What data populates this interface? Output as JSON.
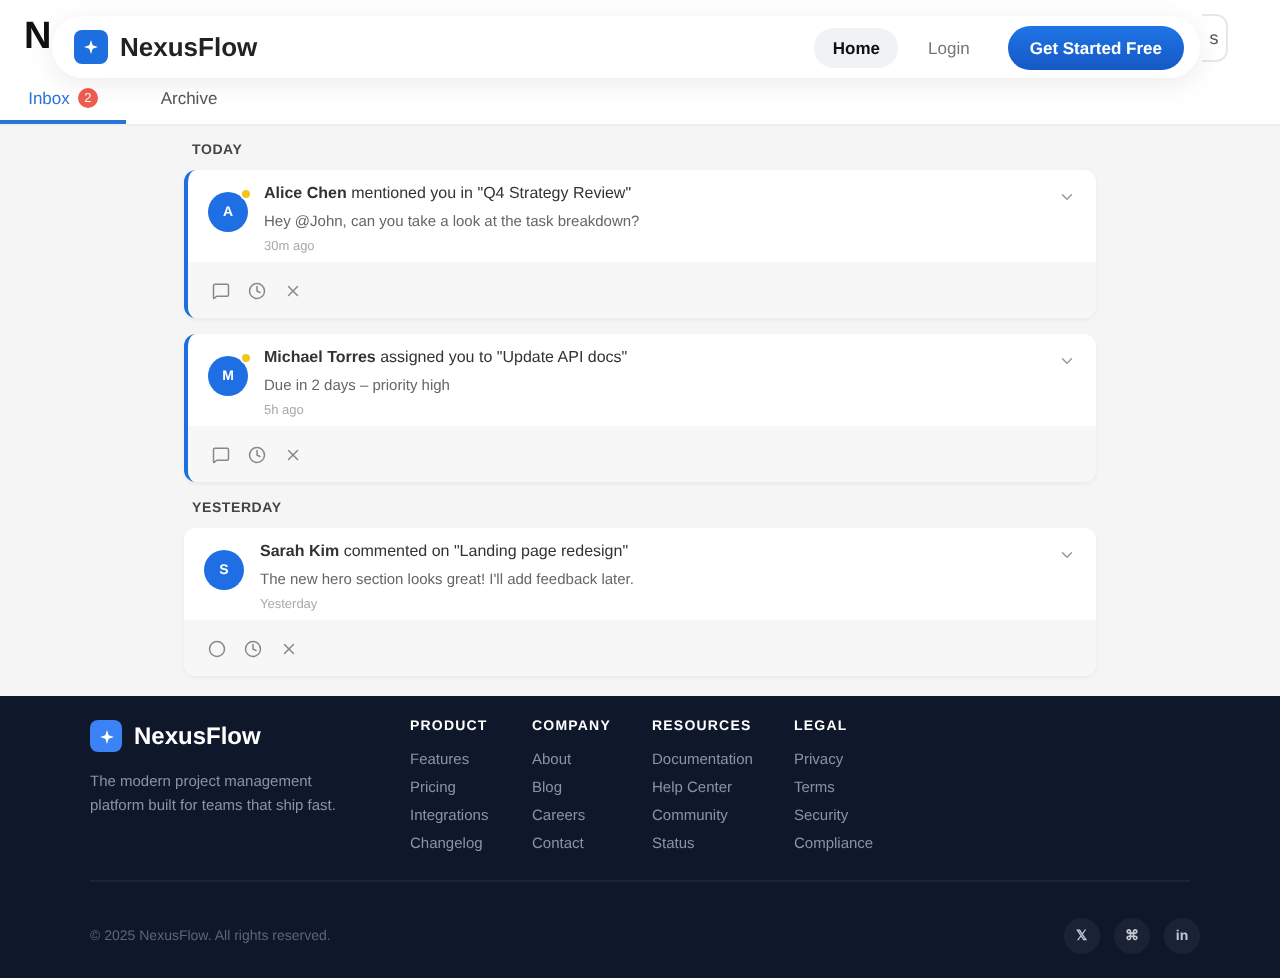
{
  "page_header": {
    "title": "N",
    "button": "s"
  },
  "nav": {
    "brand": "NexusFlow",
    "links": [
      {
        "label": "Home",
        "selected": true
      },
      {
        "label": "Login",
        "selected": false
      }
    ],
    "cta": "Get Started Free"
  },
  "tabs": [
    {
      "label": "Inbox",
      "badge": "2",
      "selected": true
    },
    {
      "label": "Archive",
      "selected": false
    }
  ],
  "groups": [
    {
      "heading": "TODAY",
      "notifications": [
        {
          "initial": "A",
          "unread": true,
          "actor": "Alice Chen",
          "action": "mentioned you in \"Q4 Strategy Review\"",
          "body": "Hey @John, can you take a look at the task breakdown?",
          "time": "30m ago",
          "actions": [
            {
              "kind": "comment"
            },
            {
              "kind": "snooze"
            },
            {
              "kind": "dismiss"
            }
          ]
        },
        {
          "initial": "M",
          "unread": true,
          "actor": "Michael Torres",
          "action": "assigned you to \"Update API docs\"",
          "body": "Due in 2 days – priority high",
          "time": "5h ago",
          "actions": [
            {
              "kind": "comment"
            },
            {
              "kind": "snooze"
            },
            {
              "kind": "dismiss"
            }
          ]
        }
      ]
    },
    {
      "heading": "YESTERDAY",
      "notifications": [
        {
          "initial": "S",
          "unread": false,
          "actor": "Sarah Kim",
          "action": "commented on \"Landing page redesign\"",
          "body": "The new hero section looks great! I'll add feedback later.",
          "time": "Yesterday",
          "actions": [
            {
              "kind": "mark"
            },
            {
              "kind": "snooze"
            },
            {
              "kind": "dismiss"
            }
          ]
        }
      ]
    }
  ],
  "footer": {
    "brand": "NexusFlow",
    "tagline": "The modern project management platform built for teams that ship fast.",
    "columns": [
      {
        "heading": "PRODUCT",
        "links": [
          "Features",
          "Pricing",
          "Integrations",
          "Changelog"
        ]
      },
      {
        "heading": "COMPANY",
        "links": [
          "About",
          "Blog",
          "Careers",
          "Contact"
        ]
      },
      {
        "heading": "RESOURCES",
        "links": [
          "Documentation",
          "Help Center",
          "Community",
          "Status"
        ]
      },
      {
        "heading": "LEGAL",
        "links": [
          "Privacy",
          "Terms",
          "Security",
          "Compliance"
        ]
      }
    ],
    "copyright": "© 2025 NexusFlow. All rights reserved.",
    "social": [
      "𝕏",
      "⌘",
      "in"
    ]
  }
}
